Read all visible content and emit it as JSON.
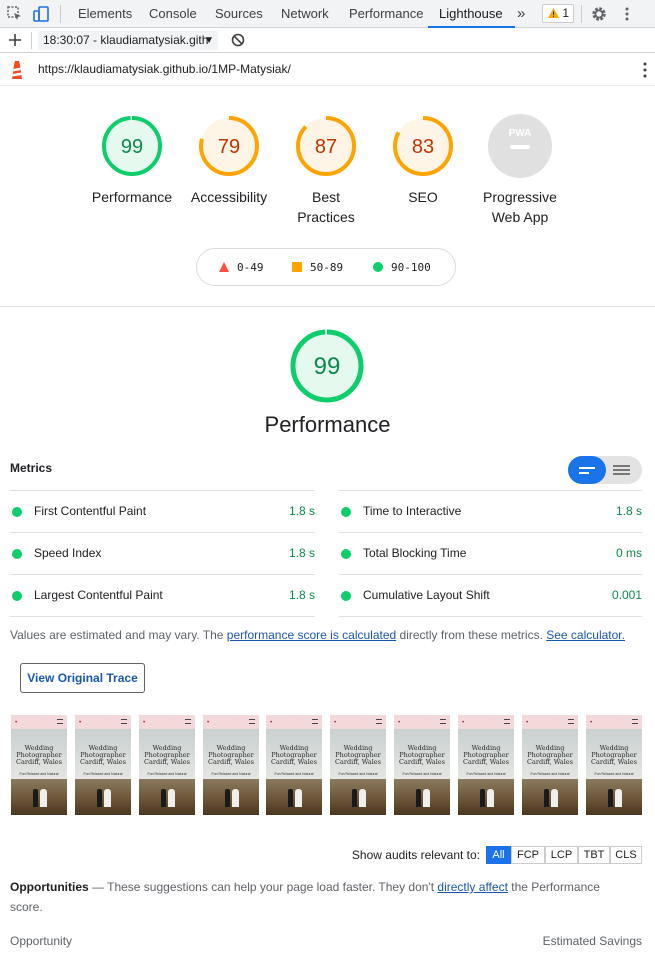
{
  "devtools": {
    "tabs": [
      "Elements",
      "Console",
      "Sources",
      "Network",
      "Performance",
      "Lighthouse"
    ],
    "active_tab": "Lighthouse",
    "more_tabs": "»",
    "warnings_count": "1"
  },
  "toolbar": {
    "report_select": "18:30:07 - klaudiamatysiak.gith"
  },
  "urlbar": {
    "url": "https://klaudiamatysiak.github.io/1MP-Matysiak/"
  },
  "colors": {
    "pass": "#0cce6b",
    "average": "#ffa400",
    "fail": "#ff4e42",
    "pass_text": "#0c8a4b",
    "average_text": "#c33300",
    "pass_fill": "#e6f9ef",
    "average_fill": "#fff5e6",
    "link": "#1a56b2"
  },
  "scores": [
    {
      "label": "Performance",
      "value": "99",
      "score": 99,
      "rating": "pass"
    },
    {
      "label": "Accessibility",
      "value": "79",
      "score": 79,
      "rating": "average"
    },
    {
      "label": "Best Practices",
      "value": "87",
      "score": 87,
      "rating": "average"
    },
    {
      "label": "SEO",
      "value": "83",
      "score": 83,
      "rating": "average"
    }
  ],
  "pwa": {
    "label": "Progressive Web App",
    "badge": "PWA"
  },
  "legend": {
    "fail": "0-49",
    "average": "50-89",
    "pass": "90-100"
  },
  "performance": {
    "score": "99",
    "score_value": 99,
    "title": "Performance"
  },
  "metrics": {
    "heading": "Metrics",
    "left": [
      {
        "label": "First Contentful Paint",
        "value": "1.8 s"
      },
      {
        "label": "Speed Index",
        "value": "1.8 s"
      },
      {
        "label": "Largest Contentful Paint",
        "value": "1.8 s"
      }
    ],
    "right": [
      {
        "label": "Time to Interactive",
        "value": "1.8 s"
      },
      {
        "label": "Total Blocking Time",
        "value": "0 ms"
      },
      {
        "label": "Cumulative Layout Shift",
        "value": "0.001"
      }
    ]
  },
  "note": {
    "part1": "Values are estimated and may vary. The ",
    "link1": "performance score is calculated",
    "part2": " directly from these metrics. ",
    "link2": "See calculator."
  },
  "trace_button": "View Original Trace",
  "thumbnail": {
    "title_lines": [
      "Wedding",
      "Photographer",
      "Cardiff, Wales"
    ],
    "subtitle": "Fun Relaxed and Natural"
  },
  "audits_filter": {
    "label": "Show audits relevant to:",
    "chips": [
      "All",
      "FCP",
      "LCP",
      "TBT",
      "CLS"
    ],
    "active": "All"
  },
  "opportunities": {
    "title": "Opportunities",
    "dash": " — ",
    "desc1": "These suggestions can help your page load faster. They don't ",
    "link": "directly affect",
    "desc2": " the Performance score.",
    "col_left": "Opportunity",
    "col_right": "Estimated Savings"
  }
}
